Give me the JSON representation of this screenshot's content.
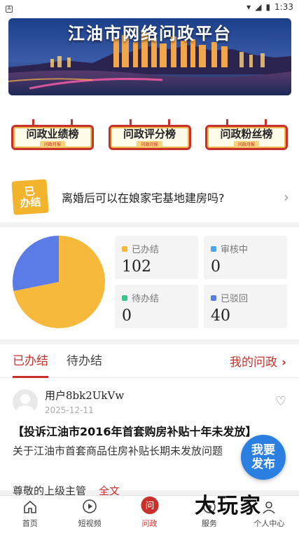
{
  "statusbar": {
    "left_icon": "A",
    "time": "1:33"
  },
  "banner": {
    "title": "江油市网络问政平台"
  },
  "boards": [
    {
      "label": "问政业绩榜",
      "sub": "问政月报"
    },
    {
      "label": "问政评分榜",
      "sub": "问政月报"
    },
    {
      "label": "问政粉丝榜",
      "sub": "问政月报"
    }
  ],
  "notice": {
    "badge_line1": "已",
    "badge_line2": "办结",
    "text": "离婚后可以在娘家宅基地建房吗?"
  },
  "stats": {
    "cards": [
      {
        "name": "已办结",
        "value": "102",
        "color": "#f6b93b"
      },
      {
        "name": "审核中",
        "value": "0",
        "color": "#4fa3ea"
      },
      {
        "name": "待办结",
        "value": "0",
        "color": "#3cc48a"
      },
      {
        "name": "已驳回",
        "value": "40",
        "color": "#5b7be6"
      }
    ]
  },
  "chart_data": {
    "type": "pie",
    "categories": [
      "已办结",
      "审核中",
      "待办结",
      "已驳回"
    ],
    "values": [
      102,
      0,
      0,
      40
    ],
    "colors": [
      "#f6b93b",
      "#4fa3ea",
      "#3cc48a",
      "#5b7be6"
    ]
  },
  "tabs": {
    "items": [
      "已办结",
      "待办结"
    ],
    "active": 0,
    "my_label": "我的问政",
    "my_arrow": "›"
  },
  "post": {
    "username": "用户8bk2UkVw",
    "date": "2025-12-11",
    "title": "【投诉江油市2016年首套购房补贴十年未发放】",
    "desc": "关于江油市首套商品住房补贴长期未发放问题",
    "more_text": "尊敬的上级主管",
    "more_link": "全文"
  },
  "fab": {
    "line1": "我要",
    "line2": "发布"
  },
  "watermark": "大玩家",
  "tabbar": [
    {
      "label": "首页",
      "icon": "home-icon"
    },
    {
      "label": "短视频",
      "icon": "video-icon"
    },
    {
      "label": "问政",
      "icon": "question-icon"
    },
    {
      "label": "服务",
      "icon": "service-icon"
    },
    {
      "label": "个人中心",
      "icon": "profile-icon"
    }
  ],
  "colors": {
    "accent": "#c9302c",
    "fab": "#2a7fe0"
  }
}
